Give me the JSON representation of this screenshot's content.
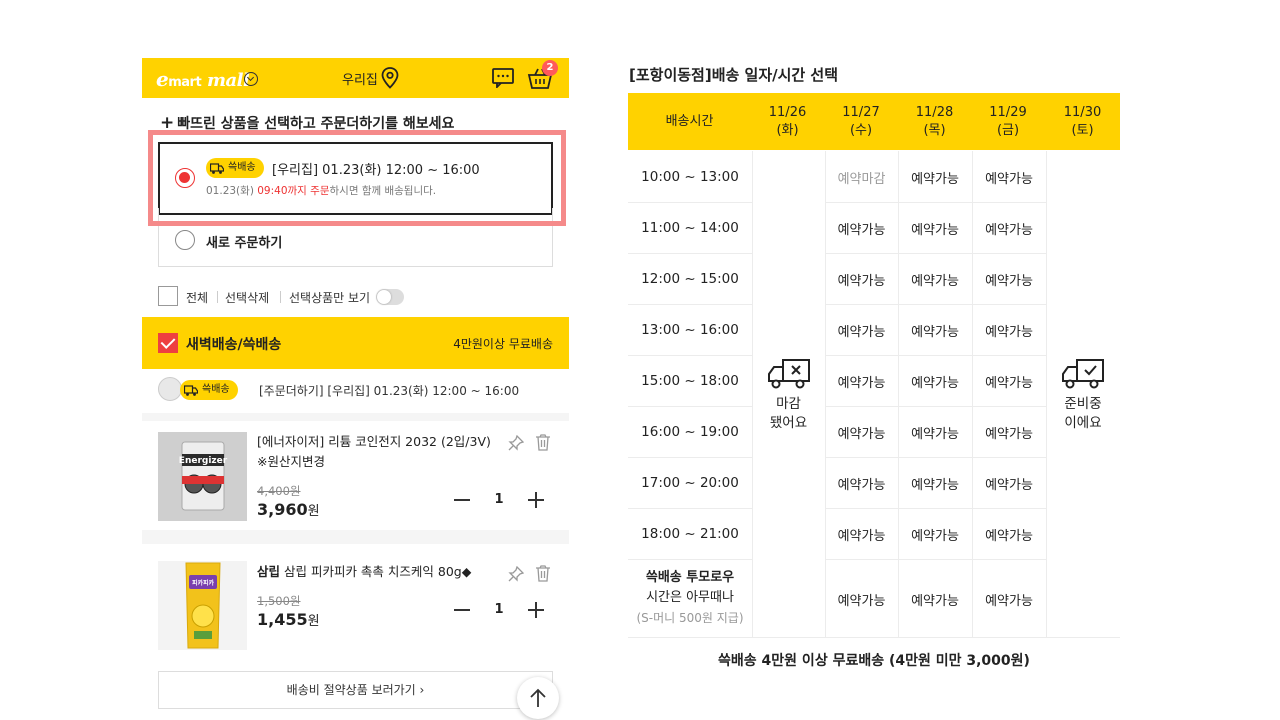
{
  "header": {
    "logo_e": "e",
    "logo_mart": "mart",
    "logo_mall": "mall",
    "address": "우리집",
    "cart_count": "2"
  },
  "prompt": "빠뜨린 상품을 선택하고 주문더하기를 해보세요",
  "options": {
    "existing": {
      "badge": "쓱배송",
      "title": "[우리집] 01.23(화) 12:00 ~ 16:00",
      "sub_prefix": "01.23(화) ",
      "sub_highlight": "09:40까지 주문",
      "sub_suffix": "하시면 함께 배송됩니다."
    },
    "new_label": "새로 주문하기"
  },
  "select_bar": {
    "all": "전체",
    "delete": "선택삭제",
    "only_selected": "선택상품만 보기"
  },
  "section": {
    "title": "새벽배송/쓱배송",
    "note": "4만원이상 무료배송",
    "badge": "쓱배송",
    "order_info": "[주문더하기] [우리집] 01.23(화) 12:00 ~ 16:00"
  },
  "products": [
    {
      "brand": "",
      "name": "[에너자이저] 리튬 코인전지 2032 (2입/3V) ※원산지변경",
      "old_price": "4,400원",
      "price": "3,960",
      "won": "원",
      "qty": "1",
      "image_label": "Energizer"
    },
    {
      "brand": "삼립",
      "name": " 삼립 피카피카 촉촉 치즈케익 80g◆",
      "old_price": "1,500원",
      "price": "1,455",
      "won": "원",
      "qty": "1",
      "image_label": "피카피카"
    }
  ],
  "more_button": "배송비 절약상품 보러가기  ›",
  "schedule": {
    "title": "[포항이동점]배송 일자/시간 선택",
    "time_header": "배송시간",
    "days": [
      {
        "date": "11/26",
        "dow": "(화)"
      },
      {
        "date": "11/27",
        "dow": "(수)"
      },
      {
        "date": "11/28",
        "dow": "(목)"
      },
      {
        "date": "11/29",
        "dow": "(금)"
      },
      {
        "date": "11/30",
        "dow": "(토)"
      }
    ],
    "slots": [
      "10:00 ~ 13:00",
      "11:00 ~ 14:00",
      "12:00 ~ 15:00",
      "13:00 ~ 16:00",
      "15:00 ~ 18:00",
      "16:00 ~ 19:00",
      "17:00 ~ 20:00",
      "18:00 ~ 21:00"
    ],
    "availability": [
      [
        "예약마감",
        "예약가능",
        "예약가능"
      ],
      [
        "예약가능",
        "예약가능",
        "예약가능"
      ],
      [
        "예약가능",
        "예약가능",
        "예약가능"
      ],
      [
        "예약가능",
        "예약가능",
        "예약가능"
      ],
      [
        "예약가능",
        "예약가능",
        "예약가능"
      ],
      [
        "예약가능",
        "예약가능",
        "예약가능"
      ],
      [
        "예약가능",
        "예약가능",
        "예약가능"
      ],
      [
        "예약가능",
        "예약가능",
        "예약가능"
      ],
      [
        "예약가능",
        "예약가능",
        "예약가능"
      ]
    ],
    "special_slot": {
      "line1": "쓱배송 투모로우",
      "line2": "시간은 아무때나",
      "line3": "(S-머니 500원 지급)"
    },
    "closed_day": {
      "line1": "마감",
      "line2": "됐어요"
    },
    "preparing_day": {
      "line1": "준비중",
      "line2": "이에요"
    },
    "footnote": "쓱배송 4만원 이상 무료배송 (4만원 미만 3,000원)"
  },
  "colors": {
    "brand_yellow": "#ffd200",
    "accent_red": "#ee4040",
    "highlight_pink": "#f58a8a"
  },
  "icons": [
    "location-pin-icon",
    "chat-icon",
    "cart-icon",
    "truck-icon",
    "pin-icon",
    "trash-icon",
    "arrow-up-icon",
    "truck-x-icon",
    "truck-check-icon"
  ]
}
